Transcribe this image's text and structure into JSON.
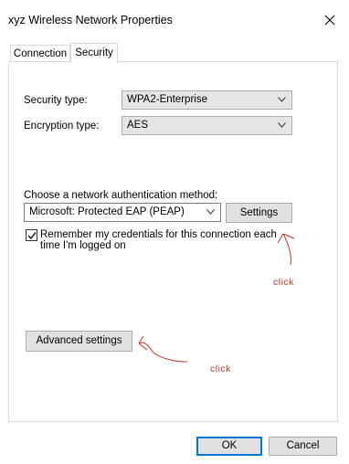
{
  "window": {
    "title": "xyz Wireless Network Properties"
  },
  "tabs": [
    {
      "label": "Connection",
      "selected": false
    },
    {
      "label": "Security",
      "selected": true
    }
  ],
  "security": {
    "security_type_label": "Security type:",
    "security_type_value": "WPA2-Enterprise",
    "encryption_type_label": "Encryption type:",
    "encryption_type_value": "AES",
    "auth_method_label": "Choose a network authentication method:",
    "auth_method_value": "Microsoft: Protected EAP (PEAP)",
    "settings_label": "Settings",
    "remember_label_line1": "Remember my credentials for this connection each",
    "remember_label_line2": "time I'm logged on",
    "remember_checked": true,
    "advanced_label": "Advanced settings"
  },
  "annotations": {
    "click_1": "click",
    "click_2": "click",
    "color": "#c0392b"
  },
  "footer": {
    "ok_label": "OK",
    "cancel_label": "Cancel"
  },
  "icons": [
    "close-icon",
    "chevron-down-icon",
    "checkmark-icon"
  ]
}
